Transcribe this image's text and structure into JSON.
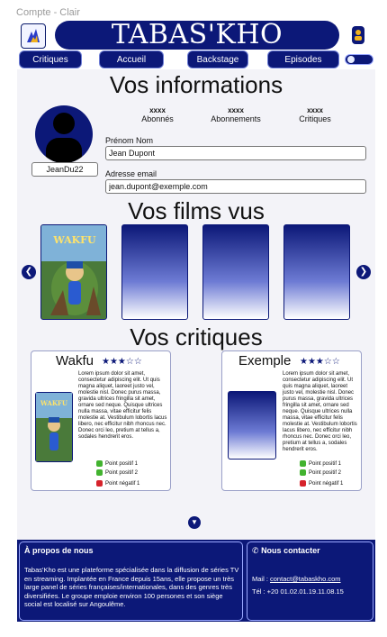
{
  "frame_label": "Compte - Clair",
  "brand": {
    "name": "TABAS'KHO"
  },
  "nav": {
    "items": [
      {
        "label": "Critiques"
      },
      {
        "label": "Accueil"
      },
      {
        "label": "Backstage"
      },
      {
        "label": "Episodes"
      }
    ]
  },
  "info": {
    "title": "Vos informations",
    "username": "JeanDu22",
    "stats": [
      {
        "value": "xxxx",
        "label": "Abonnés"
      },
      {
        "value": "xxxx",
        "label": "Abonnements"
      },
      {
        "value": "xxxx",
        "label": "Critiques"
      }
    ],
    "first_name_label": "Prénom Nom",
    "first_name_value": "Jean Dupont",
    "email_label": "Adresse email",
    "email_value": "jean.dupont@exemple.com"
  },
  "films": {
    "title": "Vos films vus",
    "first_poster_title": "WAKFU"
  },
  "reviews": {
    "title": "Vos critiques",
    "items": [
      {
        "title": "Wakfu",
        "stars": "★★★☆☆",
        "poster_title": "WAKFU",
        "text": "Lorem ipsum dolor sit amet, consectetur adipiscing elit. Ut quis magna aliquet, laoreet justo vel, molestie nisl. Donec purus massa, gravida ultrices fringilla sit amet, ornare sed neque. Quisque ultrices nulla massa, vitae efficitur felis molestie at. Vestibulum lobortis lacus libero, nec efficitur nibh rhoncus nec. Donec orci leo, pretium at tellus a, sodales hendrerit eros.",
        "pos1": "Point positif 1",
        "pos2": "Point positif 2",
        "neg1": "Point négatif 1"
      },
      {
        "title": "Exemple",
        "stars": "★★★☆☆",
        "text": "Lorem ipsum dolor sit amet, consectetur adipiscing elit. Ut quis magna aliquet, laoreet justo vel, molestie nisl. Donec purus massa, gravida ultrices fringilla sit amet, ornare sed neque. Quisque ultrices nulla massa, vitae efficitur felis molestie at. Vestibulum lobortis lacus libero, nec efficitur nibh rhoncus nec. Donec orci leo, pretium at tellus a, sodales hendrerit eros.",
        "pos1": "Point positif 1",
        "pos2": "Point positif 2",
        "neg1": "Point négatif 1"
      }
    ]
  },
  "footer": {
    "about_title": "À propos de nous",
    "about_text": "Tabas'Kho est une plateforme spécialisée dans la diffusion de séries TV en streaming. Implantée en France depuis 15ans, elle propose un très large panel de séries françaises/internationales, dans des genres très diversifiées. Le groupe emploie environ 100 persones et son siège social est localisé sur Angoulême.",
    "contact_title": "Nous contacter",
    "mail_label": "Mail : ",
    "mail_value": "contact@tabaskho.com",
    "phone": "Tél : +20 01.02.01.19.11.08.15"
  },
  "colors": {
    "primary": "#0c1878",
    "positive": "#42b32f",
    "negative": "#d6232b"
  }
}
